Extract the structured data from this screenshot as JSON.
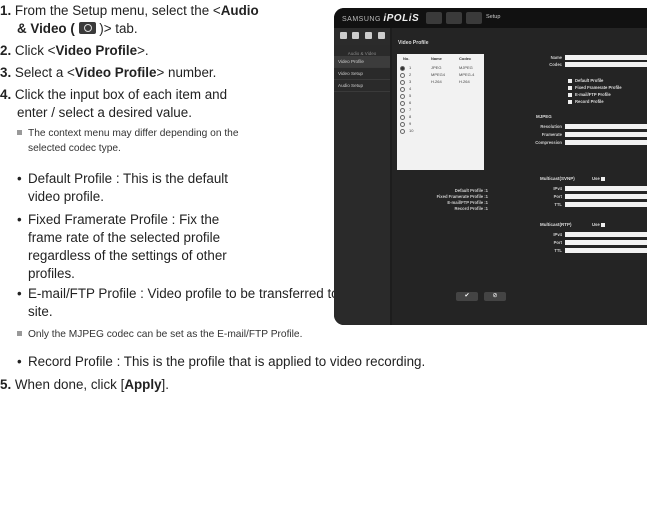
{
  "steps": {
    "s1_num": "1.",
    "s1_pre": "From the Setup menu, select the <",
    "s1_bold_a": "Audio",
    "s1_bold_b": "& Video (",
    "s1_post": ")> tab.",
    "s2_num": "2.",
    "s2_pre": "Click <",
    "s2_bold": "Video Profile",
    "s2_post": ">.",
    "s3_num": "3.",
    "s3_pre": "Select a <",
    "s3_bold": "Video Profile",
    "s3_post": "> number.",
    "s4_num": "4.",
    "s4_line1": "Click the input box of each item and",
    "s4_line2": "enter / select a desired value.",
    "note1_line1": "The context menu may differ depending on the",
    "note1_line2": "selected codec type.",
    "b1_line1": "Default Profile : This is the default",
    "b1_line2": "video profile.",
    "b2_line1": "Fixed Framerate Profile : Fix the",
    "b2_line2": "frame rate of the selected profile",
    "b2_line3": "regardless of the settings of other",
    "b2_line4": "profiles.",
    "b3_line1": "E-mail/FTP Profile : Video profile to be transferred to the specified email or FTP",
    "b3_line2": "site.",
    "note2": "Only the MJPEG codec can be set as the E-mail/FTP Profile.",
    "b4": "Record Profile : This is the profile that is applied to video recording.",
    "s5_num": "5.",
    "s5_pre": "When done, click [",
    "s5_bold": "Apply",
    "s5_post": "]."
  },
  "screenshot": {
    "brand_prefix": "SAMSUNG",
    "brand_word": "iPOLiS",
    "setup_label": "Setup",
    "side_header": "Audio & Video",
    "side_items": [
      "Video Profile",
      "Video Setup",
      "Audio Setup"
    ],
    "content_title": "Video Profile",
    "table_headers": [
      "No.",
      "Name",
      "Codec"
    ],
    "rows": [
      {
        "no": "1",
        "name": "JPEG",
        "codec": "MJPEG"
      },
      {
        "no": "2",
        "name": "MPEG4",
        "codec": "MPEG-4"
      },
      {
        "no": "3",
        "name": "H.264",
        "codec": "H.264"
      },
      {
        "no": "4",
        "name": "",
        "codec": ""
      },
      {
        "no": "5",
        "name": "",
        "codec": ""
      },
      {
        "no": "6",
        "name": "",
        "codec": ""
      },
      {
        "no": "7",
        "name": "",
        "codec": ""
      },
      {
        "no": "8",
        "name": "",
        "codec": ""
      },
      {
        "no": "9",
        "name": "",
        "codec": ""
      },
      {
        "no": "10",
        "name": "",
        "codec": ""
      }
    ],
    "profile_summary": [
      "Default Profile :1",
      "Fixed Framerate Profile :1",
      "E-mail/FTP Profile :1",
      "Record Profile :1"
    ],
    "name_label": "Name",
    "name_value": "JPEG",
    "codec_label": "Codec",
    "codec_value": "MJPEG",
    "checkboxes": [
      "Default Profile",
      "Fixed Framerate Profile",
      "E-mail/FTP Profile",
      "Record Profile"
    ],
    "mjpeg_title": "MJPEG",
    "resolution_label": "Resolution",
    "resolution_value": "1280 X 1024",
    "framerate_label": "Framerate",
    "framerate_value": "30 fps",
    "compression_label": "Compression",
    "compression_value": "10",
    "multicast_svnp": "Multicast(SVNP)",
    "multicast_rtp": "Multicast(RTP)",
    "use_label": "Use",
    "ipv4_label": "IPv4",
    "port_label": "Port",
    "ttl_label": "TTL",
    "apply_glyph": "✔",
    "cancel_glyph": "⊘"
  }
}
